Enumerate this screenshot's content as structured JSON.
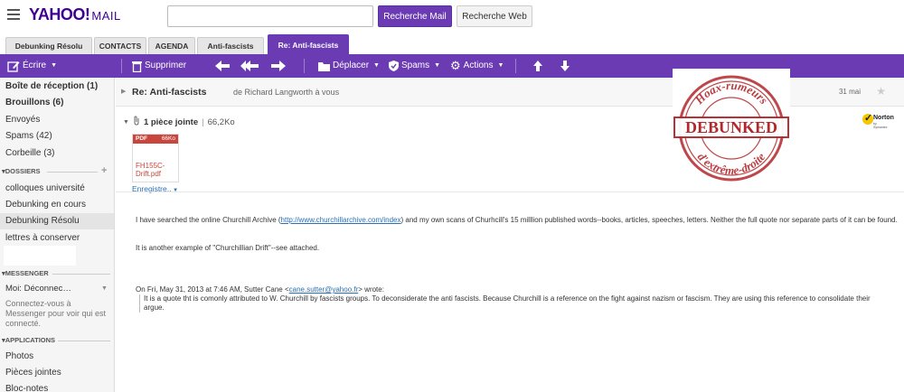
{
  "header": {
    "logo": "YAHOO!",
    "logo_mail": "MAIL",
    "search_placeholder": "",
    "search_mail_label": "Recherche Mail",
    "search_web_label": "Recherche Web"
  },
  "tabs": [
    {
      "label": "Debunking Résolu"
    },
    {
      "label": "CONTACTS"
    },
    {
      "label": "AGENDA"
    },
    {
      "label": "Anti-fascists"
    },
    {
      "label": "Re: Anti-fascists"
    }
  ],
  "toolbar": {
    "compose": "Écrire",
    "delete": "Supprimer",
    "move": "Déplacer",
    "spam": "Spams",
    "actions": "Actions"
  },
  "sidebar": {
    "inbox": "Boîte de réception (1)",
    "drafts": "Brouillons (6)",
    "sent": "Envoyés",
    "spam": "Spams (42)",
    "trash": "Corbeille (3)",
    "folders_header": "DOSSIERS",
    "folders": [
      "colloques université",
      "Debunking en cours",
      "Debunking Résolu",
      "lettres à conserver"
    ],
    "messenger_header": "MESSENGER",
    "messenger_status": "Moi:  Déconnec…",
    "messenger_info": "Connectez-vous à Messenger pour voir qui est connecté.",
    "apps_header": "APPLICATIONS",
    "apps": [
      "Photos",
      "Pièces jointes",
      "Bloc-notes"
    ]
  },
  "message": {
    "subject": "Re: Anti-fascists",
    "from": "de Richard Langworth à vous",
    "date": "31 mai",
    "attach_label": "1 pièce jointe",
    "attach_size": "66,2Ko",
    "pdf_type": "PDF",
    "pdf_size": "66Ko",
    "pdf_name": "FH155C-Drift.pdf",
    "save_label": "Enregistre..",
    "body_p1_a": "I have searched the online Churchill Archive (",
    "body_link": "http://www.churchillarchive.com/index",
    "body_p1_b": ") and my own scans of Churhcill's 15 milllion published words--books, articles, speeches, letters. Neither the full quote nor separate parts of it can be found.",
    "body_p2": "It is another example of \"Churchillian Drift\"--see attached.",
    "reply_a": "On Fri, May 31, 2013 at 7:46 AM, Sutter Cane <",
    "reply_email": "cane.sutter@yahoo.fr",
    "reply_b": "> wrote:",
    "quote": "It is a quote tht is comonly attributed to W. Churchill by fascists groups. To deconsiderate the anti fascists. Because Churchill is a reference on the fight against nazism or fascism. They are using this reference to consolidate their argue."
  },
  "norton": {
    "label": "Norton",
    "sub": "by Symantec"
  },
  "stamp": {
    "top": "Hoax-rumeurs",
    "middle": "DEBUNKED",
    "bottom": "d'extrême-droite",
    "color": "#b3282d"
  },
  "colors": {
    "accent": "#6a3bb2",
    "link": "#2b6fb5"
  }
}
